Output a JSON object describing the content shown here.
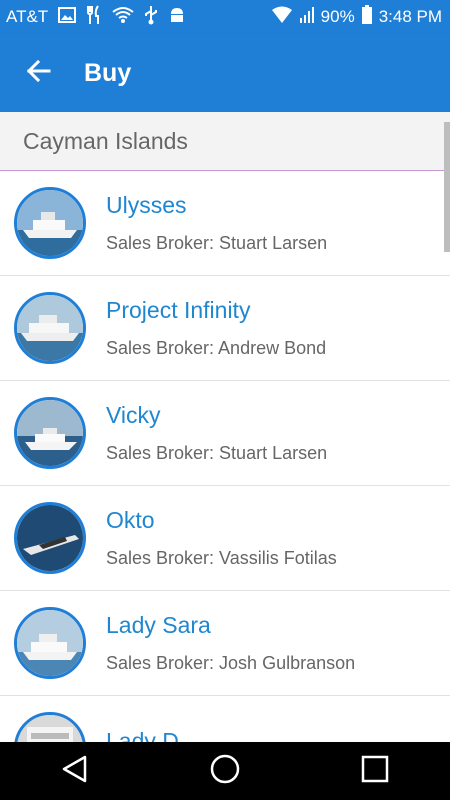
{
  "status_bar": {
    "carrier": "AT&T",
    "battery": "90%",
    "time": "3:48 PM",
    "icons_left": [
      "image-icon",
      "restaurant-icon",
      "wifi-icon",
      "usb-icon",
      "android-icon"
    ],
    "icons_right": [
      "wifi-signal-icon",
      "cell-signal-icon",
      "battery-icon"
    ]
  },
  "app_bar": {
    "title": "Buy",
    "back_icon": "arrow-back-icon",
    "color": "#1f7fd6"
  },
  "section": {
    "header": "Cayman Islands",
    "divider_color": "#c79ad3"
  },
  "items": [
    {
      "name": "Ulysses",
      "broker": "Sales Broker: Stuart Larsen"
    },
    {
      "name": "Project Infinity",
      "broker": "Sales Broker: Andrew Bond"
    },
    {
      "name": "Vicky",
      "broker": "Sales Broker: Stuart Larsen"
    },
    {
      "name": "Okto",
      "broker": "Sales Broker: Vassilis Fotilas"
    },
    {
      "name": "Lady Sara",
      "broker": "Sales Broker: Josh Gulbranson"
    },
    {
      "name": "Lady D",
      "broker": ""
    }
  ],
  "nav_bar": {
    "buttons": [
      "back-triangle-icon",
      "home-circle-icon",
      "recents-square-icon"
    ]
  }
}
